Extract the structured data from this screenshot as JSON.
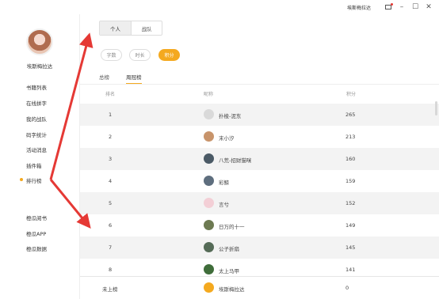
{
  "titlebar": {
    "username": "埃斯梅拉达",
    "icons": [
      "mail-icon",
      "minimize-icon",
      "maximize-icon",
      "close-icon"
    ]
  },
  "sidebar": {
    "username": "埃斯梅拉达",
    "items": [
      {
        "label": "书籍列表"
      },
      {
        "label": "在线拼字"
      },
      {
        "label": "我的战队"
      },
      {
        "label": "码字统计"
      },
      {
        "label": "活动消息"
      },
      {
        "label": "插件箱"
      },
      {
        "label": "排行榜",
        "active": true
      }
    ],
    "links": [
      {
        "label": "橙瓜阅书"
      },
      {
        "label": "橙瓜APP"
      },
      {
        "label": "橙瓜数据"
      }
    ]
  },
  "segment": {
    "personal": "个人",
    "team": "战队"
  },
  "filters": {
    "words": "字数",
    "duration": "时长",
    "points": "积分"
  },
  "subtabs": {
    "total": "总榜",
    "weekly": "周冠榜"
  },
  "table": {
    "headers": {
      "rank": "排名",
      "nickname": "昵称",
      "score": "积分"
    },
    "rows": [
      {
        "rank": "1",
        "name": "扑棱-泥东",
        "score": "265"
      },
      {
        "rank": "2",
        "name": "末小汐",
        "score": "213"
      },
      {
        "rank": "3",
        "name": "八荒-招财猫咪",
        "score": "160"
      },
      {
        "rank": "4",
        "name": "彩鲸",
        "score": "159"
      },
      {
        "rank": "5",
        "name": "言兮",
        "score": "152"
      },
      {
        "rank": "6",
        "name": "日万的十一",
        "score": "149"
      },
      {
        "rank": "7",
        "name": "公子折扇",
        "score": "145"
      },
      {
        "rank": "8",
        "name": "太上马甲",
        "score": "141"
      }
    ],
    "self": {
      "rank": "未上榜",
      "name": "埃斯梅拉达",
      "score": "0"
    }
  },
  "colors": {
    "accent": "#f4a91f",
    "annotation": "#e53935",
    "row_shade": "#f3f3f3"
  }
}
